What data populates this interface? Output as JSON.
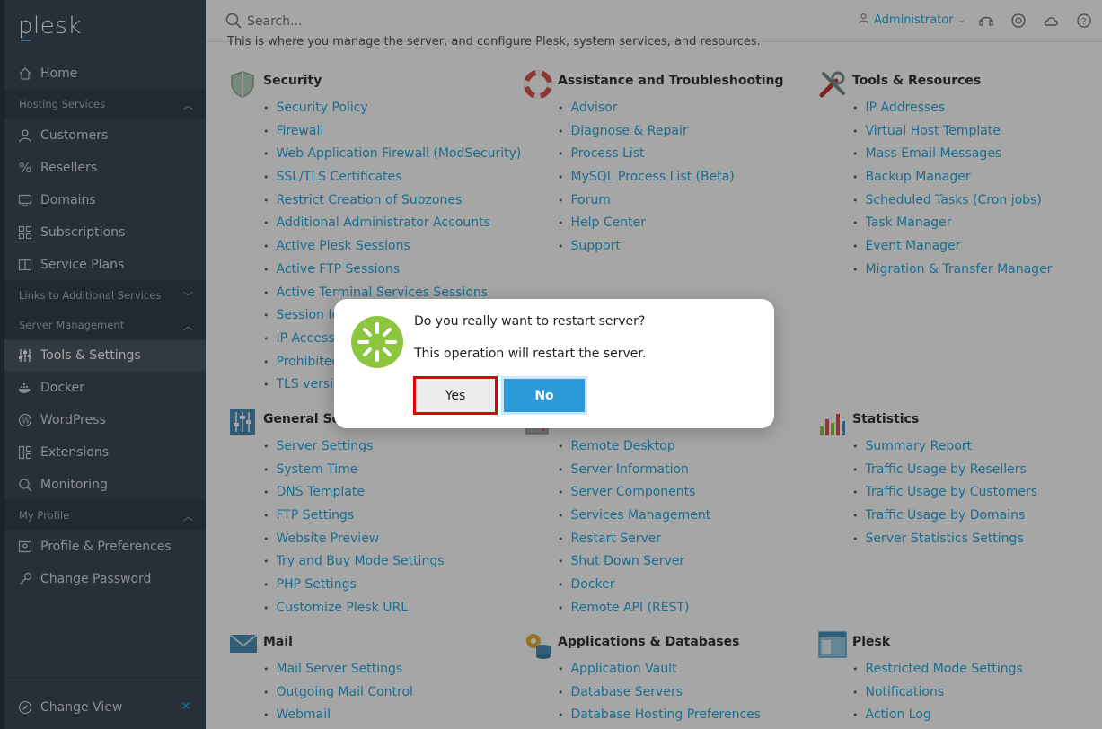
{
  "header": {
    "search_placeholder": "Search...",
    "user_label": "Administrator"
  },
  "sidebar": {
    "logo": "plesk",
    "home": "Home",
    "sections": {
      "hosting": "Hosting Services",
      "links": "Links to Additional Services",
      "server": "Server Management",
      "profile": "My Profile"
    },
    "hosting_items": [
      "Customers",
      "Resellers",
      "Domains",
      "Subscriptions",
      "Service Plans"
    ],
    "server_items": [
      "Tools & Settings",
      "Docker",
      "WordPress",
      "Extensions",
      "Monitoring"
    ],
    "profile_items": [
      "Profile & Preferences",
      "Change Password"
    ],
    "change_view": "Change View"
  },
  "content": {
    "intro": "This is where you manage the server, and configure Plesk, system services, and resources.",
    "groups": {
      "security": {
        "title": "Security",
        "items": [
          "Security Policy",
          "Firewall",
          "Web Application Firewall (ModSecurity)",
          "SSL/TLS Certificates",
          "Restrict Creation of Subzones",
          "Additional Administrator Accounts",
          "Active Plesk Sessions",
          "Active FTP Sessions",
          "Active Terminal Services Sessions",
          "Session Id",
          "IP Access",
          "Prohibited",
          "TLS versio"
        ]
      },
      "assistance": {
        "title": "Assistance and Troubleshooting",
        "items": [
          "Advisor",
          "Diagnose & Repair",
          "Process List",
          "MySQL Process List (Beta)",
          "Forum",
          "Help Center",
          "Support"
        ]
      },
      "tools": {
        "title": "Tools & Resources",
        "items": [
          "IP Addresses",
          "Virtual Host Template",
          "Mass Email Messages",
          "Backup Manager",
          "Scheduled Tasks (Cron jobs)",
          "Task Manager",
          "Event Manager",
          "Migration & Transfer Manager"
        ]
      },
      "general": {
        "title": "General Set",
        "items": [
          "Server Settings",
          "System Time",
          "DNS Template",
          "FTP Settings",
          "Website Preview",
          "Try and Buy Mode Settings",
          "PHP Settings",
          "Customize Plesk URL"
        ]
      },
      "server": {
        "items": [
          "Remote Desktop",
          "Server Information",
          "Server Components",
          "Services Management",
          "Restart Server",
          "Shut Down Server",
          "Docker",
          "Remote API (REST)"
        ]
      },
      "statistics": {
        "title": "Statistics",
        "items": [
          "Summary Report",
          "Traffic Usage by Resellers",
          "Traffic Usage by Customers",
          "Traffic Usage by Domains",
          "Server Statistics Settings"
        ]
      },
      "mail": {
        "title": "Mail",
        "items": [
          "Mail Server Settings",
          "Outgoing Mail Control",
          "Webmail"
        ]
      },
      "apps": {
        "title": "Applications & Databases",
        "items": [
          "Application Vault",
          "Database Servers",
          "Database Hosting Preferences"
        ]
      },
      "plesk": {
        "title": "Plesk",
        "items": [
          "Restricted Mode Settings",
          "Notifications",
          "Action Log"
        ]
      }
    }
  },
  "dialog": {
    "question": "Do you really want to restart server?",
    "message": "This operation will restart the server.",
    "yes": "Yes",
    "no": "No"
  },
  "colors": {
    "link": "#28aade",
    "sidebar": "#3d4a56",
    "primary_button": "#2b9ad6",
    "highlight": "#e00000",
    "icon_green": "#8cc63f"
  }
}
